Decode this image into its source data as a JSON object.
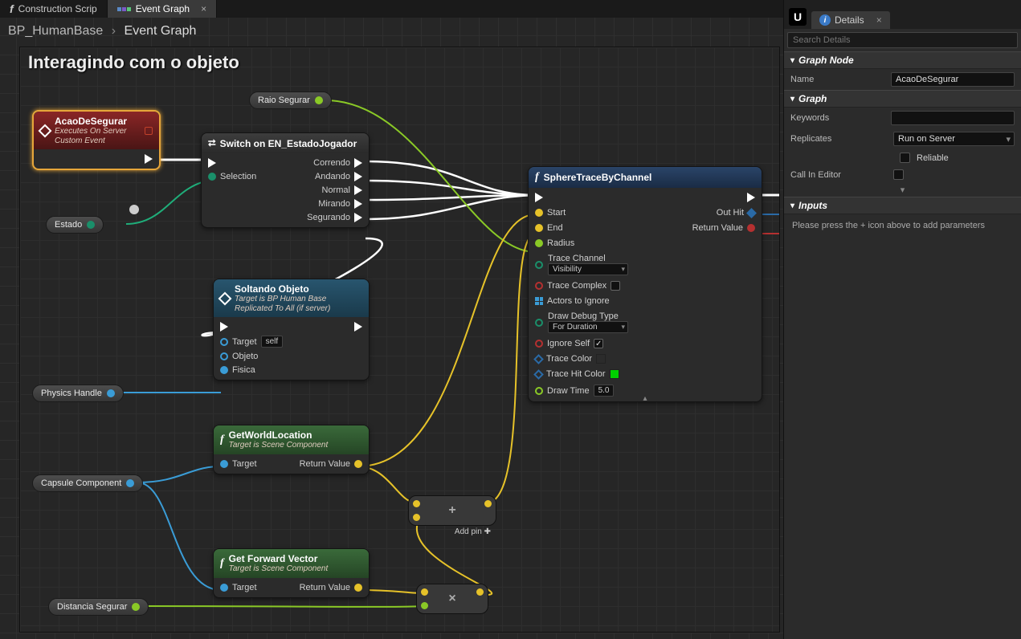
{
  "tabs": {
    "construction": "Construction Scrip",
    "event_graph": "Event Graph"
  },
  "breadcrumb": {
    "root": "BP_HumanBase",
    "leaf": "Event Graph"
  },
  "comment": {
    "title": "Interagindo com o objeto"
  },
  "vars": {
    "raio": "Raio Segurar",
    "estado": "Estado",
    "physics": "Physics Handle",
    "capsule": "Capsule Component",
    "distancia": "Distancia Segurar"
  },
  "nodes": {
    "acao": {
      "title": "AcaoDeSegurar",
      "sub1": "Executes On Server",
      "sub2": "Custom Event"
    },
    "switch": {
      "title": "Switch on EN_EstadoJogador",
      "selection": "Selection",
      "out": [
        "Correndo",
        "Andando",
        "Normal",
        "Mirando",
        "Segurando"
      ]
    },
    "soltando": {
      "title": "Soltando Objeto",
      "sub1": "Target is BP Human Base",
      "sub2": "Replicated To All (if server)",
      "target": "Target",
      "self": "self",
      "objeto": "Objeto",
      "fisica": "Fisica"
    },
    "getworld": {
      "title": "GetWorldLocation",
      "sub": "Target is Scene Component",
      "target": "Target",
      "return": "Return Value"
    },
    "getfwd": {
      "title": "Get Forward Vector",
      "sub": "Target is Scene Component",
      "target": "Target",
      "return": "Return Value"
    },
    "sphere": {
      "title": "SphereTraceByChannel",
      "start": "Start",
      "end": "End",
      "radius": "Radius",
      "tc_label": "Trace Channel",
      "tc_value": "Visibility",
      "tcomplex": "Trace Complex",
      "actors": "Actors to Ignore",
      "ddt_label": "Draw Debug Type",
      "ddt_value": "For Duration",
      "ignore": "Ignore Self",
      "tcolor": "Trace Color",
      "thcolor": "Trace Hit Color",
      "dtime": "Draw Time",
      "dtime_v": "5.0",
      "outhit": "Out Hit",
      "return": "Return Value",
      "colors": {
        "trace": "#ff0000",
        "hit": "#00d000"
      }
    },
    "addpin": "Add pin"
  },
  "panel": {
    "details": "Details",
    "search_ph": "Search Details",
    "sections": {
      "graph_node": "Graph Node",
      "graph": "Graph",
      "inputs": "Inputs"
    },
    "name_label": "Name",
    "name_value": "AcaoDeSegurar",
    "keywords": "Keywords",
    "replicates": "Replicates",
    "replicates_value": "Run on Server",
    "reliable": "Reliable",
    "callineditor": "Call In Editor",
    "inputs_note": "Please press the + icon above to add parameters"
  }
}
